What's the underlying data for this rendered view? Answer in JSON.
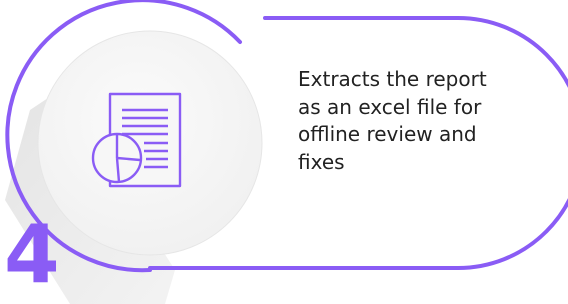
{
  "step": {
    "number": "4",
    "description": "Extracts the report as an excel file for offline review and fixes",
    "icon": "report-chart-document-icon"
  },
  "colors": {
    "accent": "#8a5cf5",
    "text": "#222222",
    "circle": "#f7f7f7",
    "shadow": "#e7e7e7"
  }
}
